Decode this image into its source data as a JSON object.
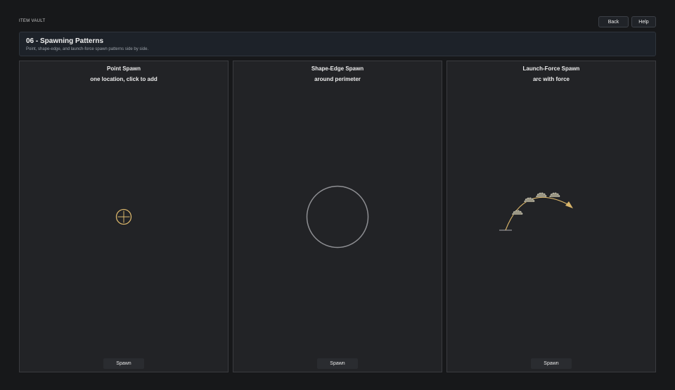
{
  "app": {
    "label": "ITEM VAULT"
  },
  "toolbar": {
    "back_label": "Back",
    "help_label": "Help"
  },
  "header": {
    "title": "06 - Spawning Patterns",
    "subtitle": "Point, shape-edge, and launch-force spawn patterns side by side."
  },
  "cards": [
    {
      "title": "Point Spawn",
      "subtitle": "one location, click to add",
      "button": "Spawn",
      "icon": "crosshair-icon"
    },
    {
      "title": "Shape-Edge Spawn",
      "subtitle": "around perimeter",
      "button": "Spawn",
      "icon": "circle-perimeter"
    },
    {
      "title": "Launch-Force Spawn",
      "subtitle": "arc with force",
      "button": "Spawn",
      "icon": "launch-arc"
    }
  ],
  "colors": {
    "accent": "#d8b46a",
    "circle": "#8e8f93",
    "background": "#17181a",
    "card": "#222326"
  }
}
